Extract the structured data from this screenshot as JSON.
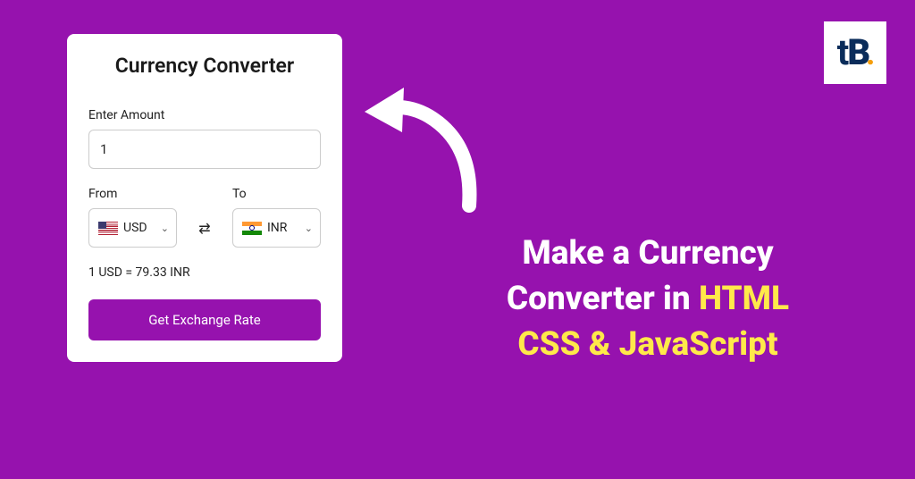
{
  "card": {
    "title": "Currency Converter",
    "amount_label": "Enter Amount",
    "amount_value": "1",
    "from_label": "From",
    "to_label": "To",
    "from_currency": "USD",
    "to_currency": "INR",
    "exchange_rate": "1 USD = 79.33 INR",
    "button_label": "Get Exchange Rate"
  },
  "headline": {
    "line1": "Make a Currency",
    "line2_part1": "Converter in ",
    "line2_highlight": "HTML",
    "line3_highlight": "CSS & JavaScript"
  },
  "logo": {
    "t": "t",
    "b": "B",
    "dot": "."
  }
}
